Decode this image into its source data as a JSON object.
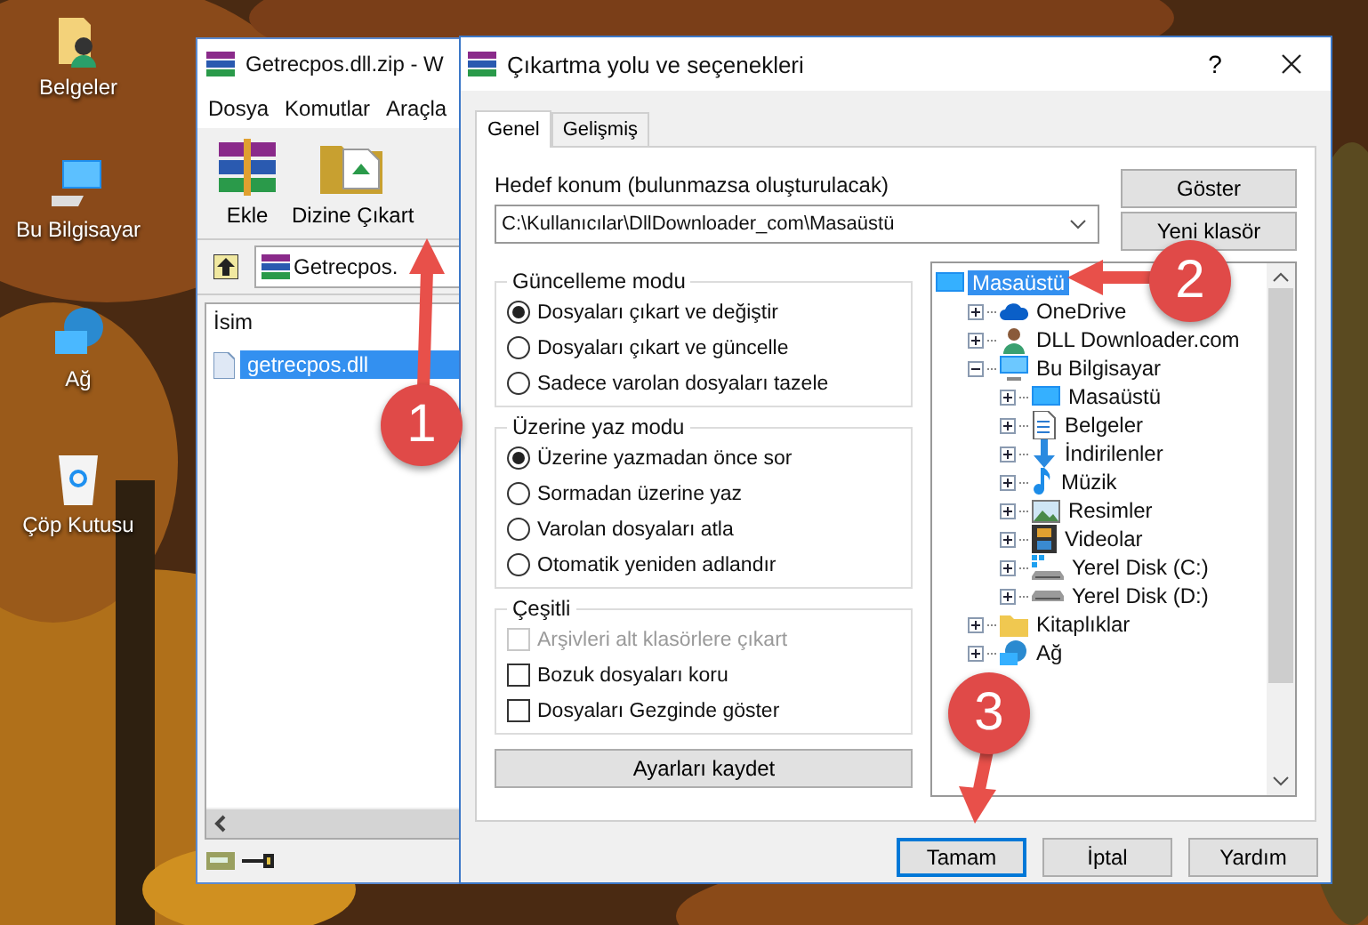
{
  "desktop_icons": [
    {
      "label": "Belgeler",
      "kind": "documents"
    },
    {
      "label": "Bu Bilgisayar",
      "kind": "computer"
    },
    {
      "label": "Ağ",
      "kind": "network"
    },
    {
      "label": "Çöp Kutusu",
      "kind": "recycle"
    }
  ],
  "archiver_window": {
    "title": "Getrecpos.dll.zip - W",
    "menu": [
      "Dosya",
      "Komutlar",
      "Araçla"
    ],
    "toolbar": [
      {
        "label": "Ekle",
        "kind": "add"
      },
      {
        "label": "Dizine Çıkart",
        "kind": "extract"
      }
    ],
    "path": "Getrecpos.",
    "columns": [
      "İsim"
    ],
    "files": [
      {
        "name": "getrecpos.dll",
        "selected": true
      }
    ]
  },
  "dialog": {
    "title": "Çıkartma yolu ve seçenekleri",
    "help": "?",
    "tabs": [
      {
        "label": "Genel",
        "selected": true
      },
      {
        "label": "Gelişmiş",
        "selected": false
      }
    ],
    "destination": {
      "label": "Hedef konum (bulunmazsa oluşturulacak)",
      "value": "C:\\Kullanıcılar\\DllDownloader_com\\Masaüstü"
    },
    "side_buttons": [
      "Göster",
      "Yeni klasör"
    ],
    "update_mode": {
      "title": "Güncelleme modu",
      "options": [
        {
          "label": "Dosyaları çıkart ve değiştir",
          "selected": true
        },
        {
          "label": "Dosyaları çıkart ve güncelle",
          "selected": false
        },
        {
          "label": "Sadece varolan dosyaları tazele",
          "selected": false
        }
      ]
    },
    "overwrite_mode": {
      "title": "Üzerine yaz modu",
      "options": [
        {
          "label": "Üzerine yazmadan önce sor",
          "selected": true
        },
        {
          "label": "Sormadan üzerine yaz",
          "selected": false
        },
        {
          "label": "Varolan dosyaları atla",
          "selected": false
        },
        {
          "label": "Otomatik yeniden adlandır",
          "selected": false
        }
      ]
    },
    "misc": {
      "title": "Çeşitli",
      "options": [
        {
          "label": "Arşivleri alt klasörlere çıkart",
          "checked": false,
          "disabled": true
        },
        {
          "label": "Bozuk dosyaları koru",
          "checked": false,
          "disabled": false
        },
        {
          "label": "Dosyaları Gezginde göster",
          "checked": false,
          "disabled": false
        }
      ]
    },
    "save_button": "Ayarları kaydet",
    "tree": [
      {
        "label": "Masaüstü",
        "kind": "desktop",
        "selected": true,
        "children": [
          {
            "label": "OneDrive",
            "kind": "cloud",
            "selected": false,
            "expanded": false
          },
          {
            "label": "DLL Downloader.com",
            "kind": "user",
            "selected": false,
            "expanded": false
          },
          {
            "label": "Bu Bilgisayar",
            "kind": "computer",
            "selected": false,
            "expanded": true,
            "children": [
              {
                "label": "Masaüstü",
                "kind": "desktop",
                "selected": false,
                "expanded": false
              },
              {
                "label": "Belgeler",
                "kind": "documents",
                "selected": false,
                "expanded": false
              },
              {
                "label": "İndirilenler",
                "kind": "download",
                "selected": false,
                "expanded": false
              },
              {
                "label": "Müzik",
                "kind": "music",
                "selected": false,
                "expanded": false
              },
              {
                "label": "Resimler",
                "kind": "pictures",
                "selected": false,
                "expanded": false
              },
              {
                "label": "Videolar",
                "kind": "videos",
                "selected": false,
                "expanded": false
              },
              {
                "label": "Yerel Disk (C:)",
                "kind": "system_drive",
                "selected": false,
                "expanded": false
              },
              {
                "label": "Yerel Disk (D:)",
                "kind": "drive",
                "selected": false,
                "expanded": false
              }
            ]
          },
          {
            "label": "Kitaplıklar",
            "kind": "library",
            "selected": false,
            "expanded": false
          },
          {
            "label": "Ağ",
            "kind": "network",
            "selected": false,
            "expanded": false
          }
        ]
      }
    ],
    "buttons": [
      {
        "label": "Tamam",
        "focused": true
      },
      {
        "label": "İptal",
        "focused": false
      },
      {
        "label": "Yardım",
        "focused": false
      }
    ]
  },
  "callouts": [
    {
      "label": "1"
    },
    {
      "label": "2"
    },
    {
      "label": "3"
    }
  ]
}
